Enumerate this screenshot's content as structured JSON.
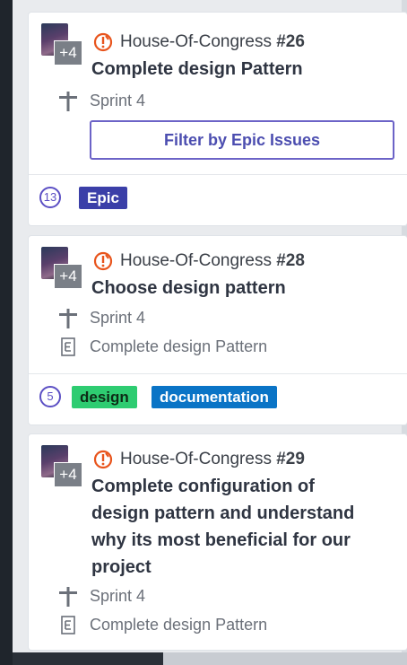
{
  "cards": [
    {
      "repo": "House-Of-Congress",
      "number": "#26",
      "title": "Complete design Pattern",
      "avatar_more": "+4",
      "sprint": "Sprint 4",
      "button": "Filter by Epic Issues",
      "count": "13",
      "labels": [
        {
          "text": "Epic",
          "color": "#3b3fa8"
        }
      ]
    },
    {
      "repo": "House-Of-Congress",
      "number": "#28",
      "title": "Choose design pattern",
      "avatar_more": "+4",
      "sprint": "Sprint 4",
      "epic": "Complete design Pattern",
      "count": "5",
      "labels": [
        {
          "text": "design",
          "color": "#2ecc71"
        },
        {
          "text": "documentation",
          "color": "#0a74c6"
        }
      ]
    },
    {
      "repo": "House-Of-Congress",
      "number": "#29",
      "title_lines": [
        "Complete configuration of",
        "design pattern and understand",
        "why its most beneficial for our",
        "project"
      ],
      "avatar_more": "+4",
      "sprint": "Sprint 4",
      "epic": "Complete design Pattern"
    }
  ],
  "colors": {
    "issue_icon": "#e8541c",
    "accent": "#5b4fc4"
  },
  "icons": {
    "issue": "issue-epic-icon",
    "sprint": "milestone-icon",
    "epic": "epic-document-icon"
  }
}
